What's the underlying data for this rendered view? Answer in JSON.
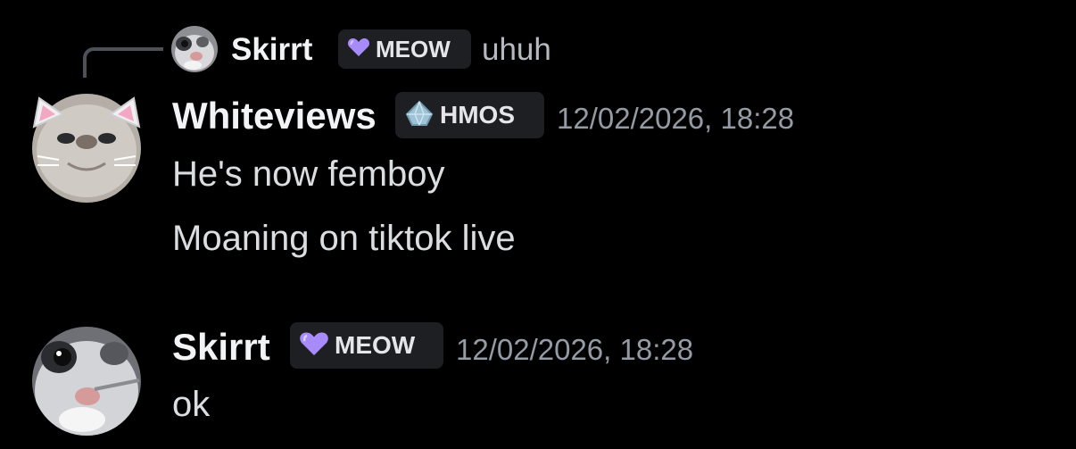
{
  "reply": {
    "author": "Skirrt",
    "tag": "MEOW",
    "text": "uhuh"
  },
  "messages": [
    {
      "author": "Whiteviews",
      "tag": "HMOS",
      "timestamp": "12/02/2026, 18:28",
      "lines": [
        "He's now femboy",
        "Moaning on tiktok live"
      ]
    },
    {
      "author": "Skirrt",
      "tag": "MEOW",
      "timestamp": "12/02/2026, 18:28",
      "lines": [
        "ok"
      ]
    }
  ],
  "colors": {
    "background": "#000000",
    "tag_bg": "#1e1f22",
    "reply_line": "#4e5058",
    "timestamp": "#949ba4",
    "meow_heart": "#a78bfa",
    "hmos_gem": "#9ec3d6"
  },
  "icons": {
    "meow_tag_icon": "purple-heart-icon",
    "hmos_tag_icon": "blue-gem-icon"
  }
}
